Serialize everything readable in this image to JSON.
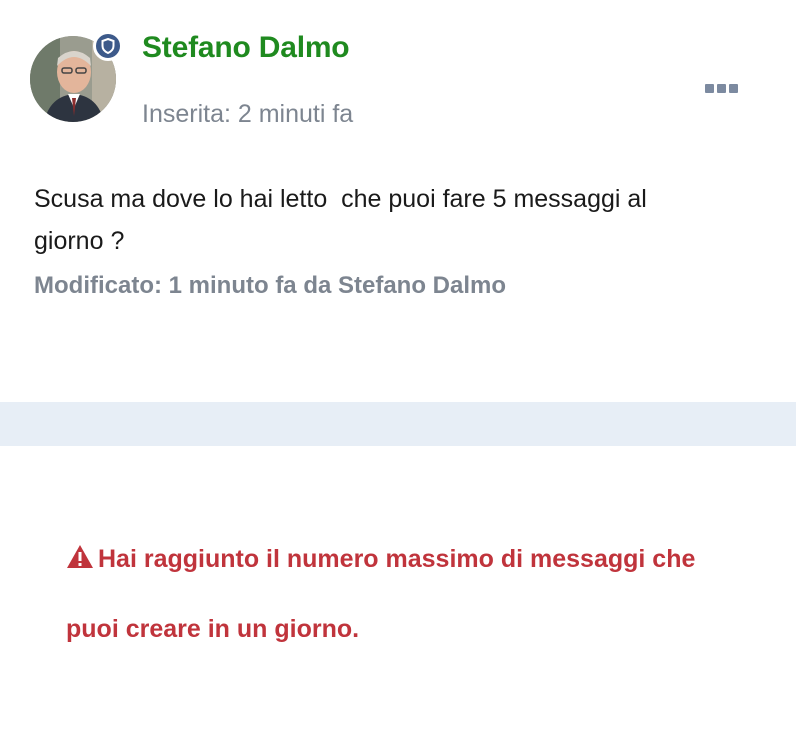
{
  "post": {
    "author_name": "Stefano Dalmo",
    "posted_label": "Inserita: 2 minuti fa",
    "body_text": "Scusa ma dove lo hai letto  che puoi fare 5 messaggi al\ngiorno ?",
    "edited_label": "Modificato: 1 minuto fa da Stefano Dalmo",
    "badge_icon": "shield-icon",
    "menu_icon": "more-dots-icon"
  },
  "notice": {
    "icon": "warning-icon",
    "text": "Hai raggiunto il numero massimo di messaggi che puoi creare in un giorno."
  },
  "colors": {
    "author_name": "#1f8a1f",
    "muted_text": "#7d8590",
    "badge": "#3d5a8a",
    "separator": "#e7eef6",
    "error": "#c0343c"
  }
}
